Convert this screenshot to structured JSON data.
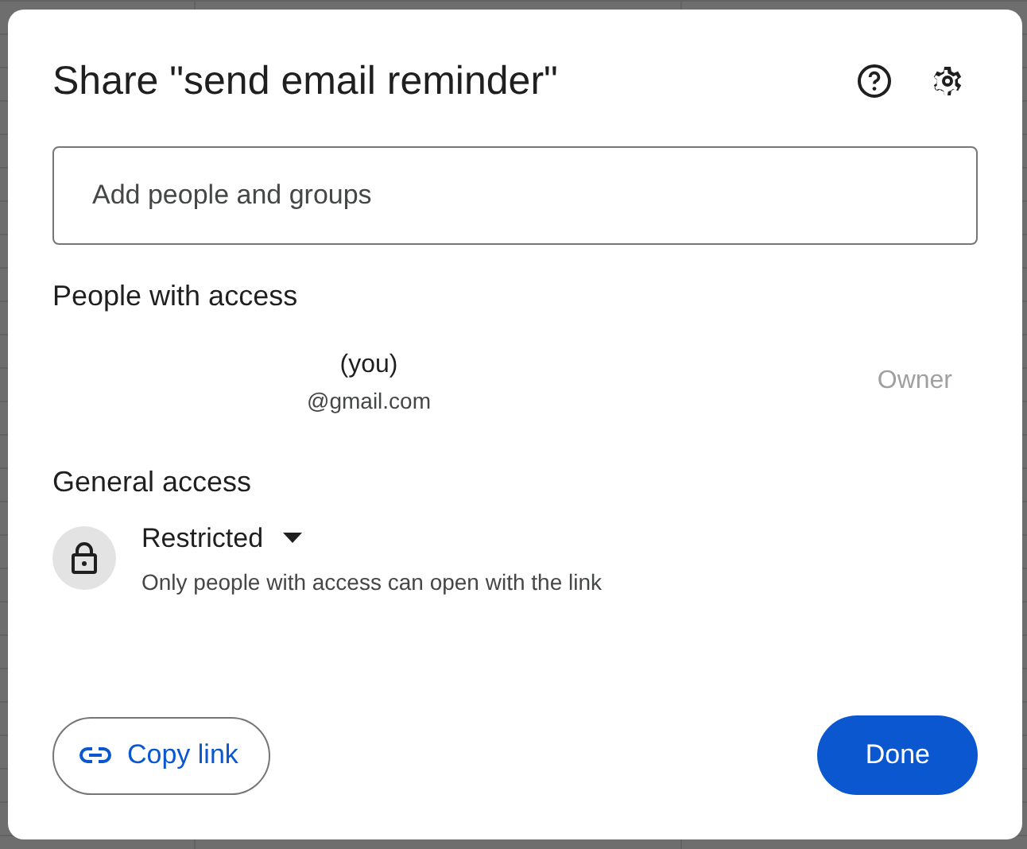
{
  "dialog": {
    "title": "Share \"send email reminder\"",
    "add_field": {
      "placeholder": "Add people and groups"
    },
    "people_heading": "People with access",
    "people": [
      {
        "name": "(you)",
        "email": "@gmail.com",
        "role": "Owner"
      }
    ],
    "general_heading": "General access",
    "general_access": {
      "setting": "Restricted",
      "description": "Only people with access can open with the link"
    },
    "buttons": [
      {
        "label": "Copy link",
        "kind": "outline"
      },
      {
        "label": "Done",
        "kind": "primary"
      }
    ]
  }
}
